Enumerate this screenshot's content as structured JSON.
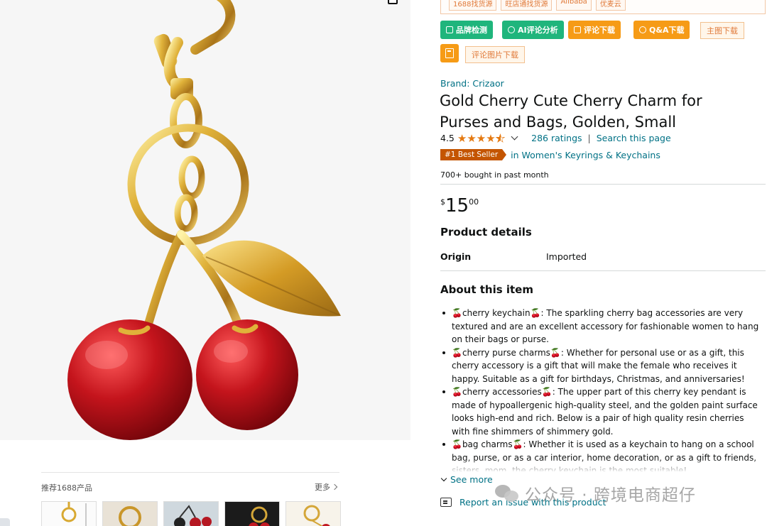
{
  "plugin": {
    "tags": [
      "1688找货源",
      "旺店通找货源",
      "Alibaba",
      "优麦云"
    ],
    "buttons": {
      "brand_check": "品牌检测",
      "ai_review": "AI评论分析",
      "review_download": "评论下载",
      "qa_download": "Q&A下载",
      "main_image_download": "主图下载",
      "review_image_download": "评论图片下载"
    },
    "colors": {
      "green": "#1fb57c",
      "orange": "#f69b16"
    }
  },
  "recommend": {
    "title": "推荐1688产品",
    "more": "更多"
  },
  "product": {
    "brand": "Brand: Crizaor",
    "title": "Gold Cherry Cute Cherry Charm for Purses and Bags, Golden, Small",
    "rating_value": "4.5",
    "rating_stars": 4.5,
    "ratings_count": "286 ratings",
    "search_page": "Search this page",
    "separator": "|",
    "bestseller_badge": "#1 Best Seller",
    "bestseller_category": "in Women's Keyrings & Keychains",
    "bought": "700+ bought in past month",
    "price_symbol": "$",
    "price_whole": "15",
    "price_fraction": "00"
  },
  "details": {
    "title": "Product details",
    "origin_label": "Origin",
    "origin_value": "Imported"
  },
  "about": {
    "title": "About this item",
    "bullets": [
      "🍒cherry keychain🍒: The sparkling cherry bag accessories are very textured and are an excellent accessory for fashionable women to hang on their bags or purse.",
      "🍒cherry purse charms🍒: Whether for personal use or as a gift, this cherry accessory is a gift that will make the female who receives it happy. Suitable as a gift for birthdays, Christmas, and anniversaries!",
      "🍒cherry accessories🍒: The upper part of this cherry key pendant is made of hypoallergenic high-quality steel, and the golden paint surface looks high-end and rich. Below is a pair of high quality resin cherries with fine shimmers of shimmery gold.",
      "🍒bag charms🍒: Whether it is used as a keychain to hang on a school bag, purse, or as a car interior, home decoration, or as a gift to friends, sisters, mom, the cherry keychain is the most suitable!"
    ],
    "see_more": "See more",
    "report": "Report an issue with this product"
  },
  "watermark": "公众号 · 跨境电商超仔",
  "colors": {
    "link": "#007185",
    "star": "#e47911",
    "badge": "#c45500"
  }
}
